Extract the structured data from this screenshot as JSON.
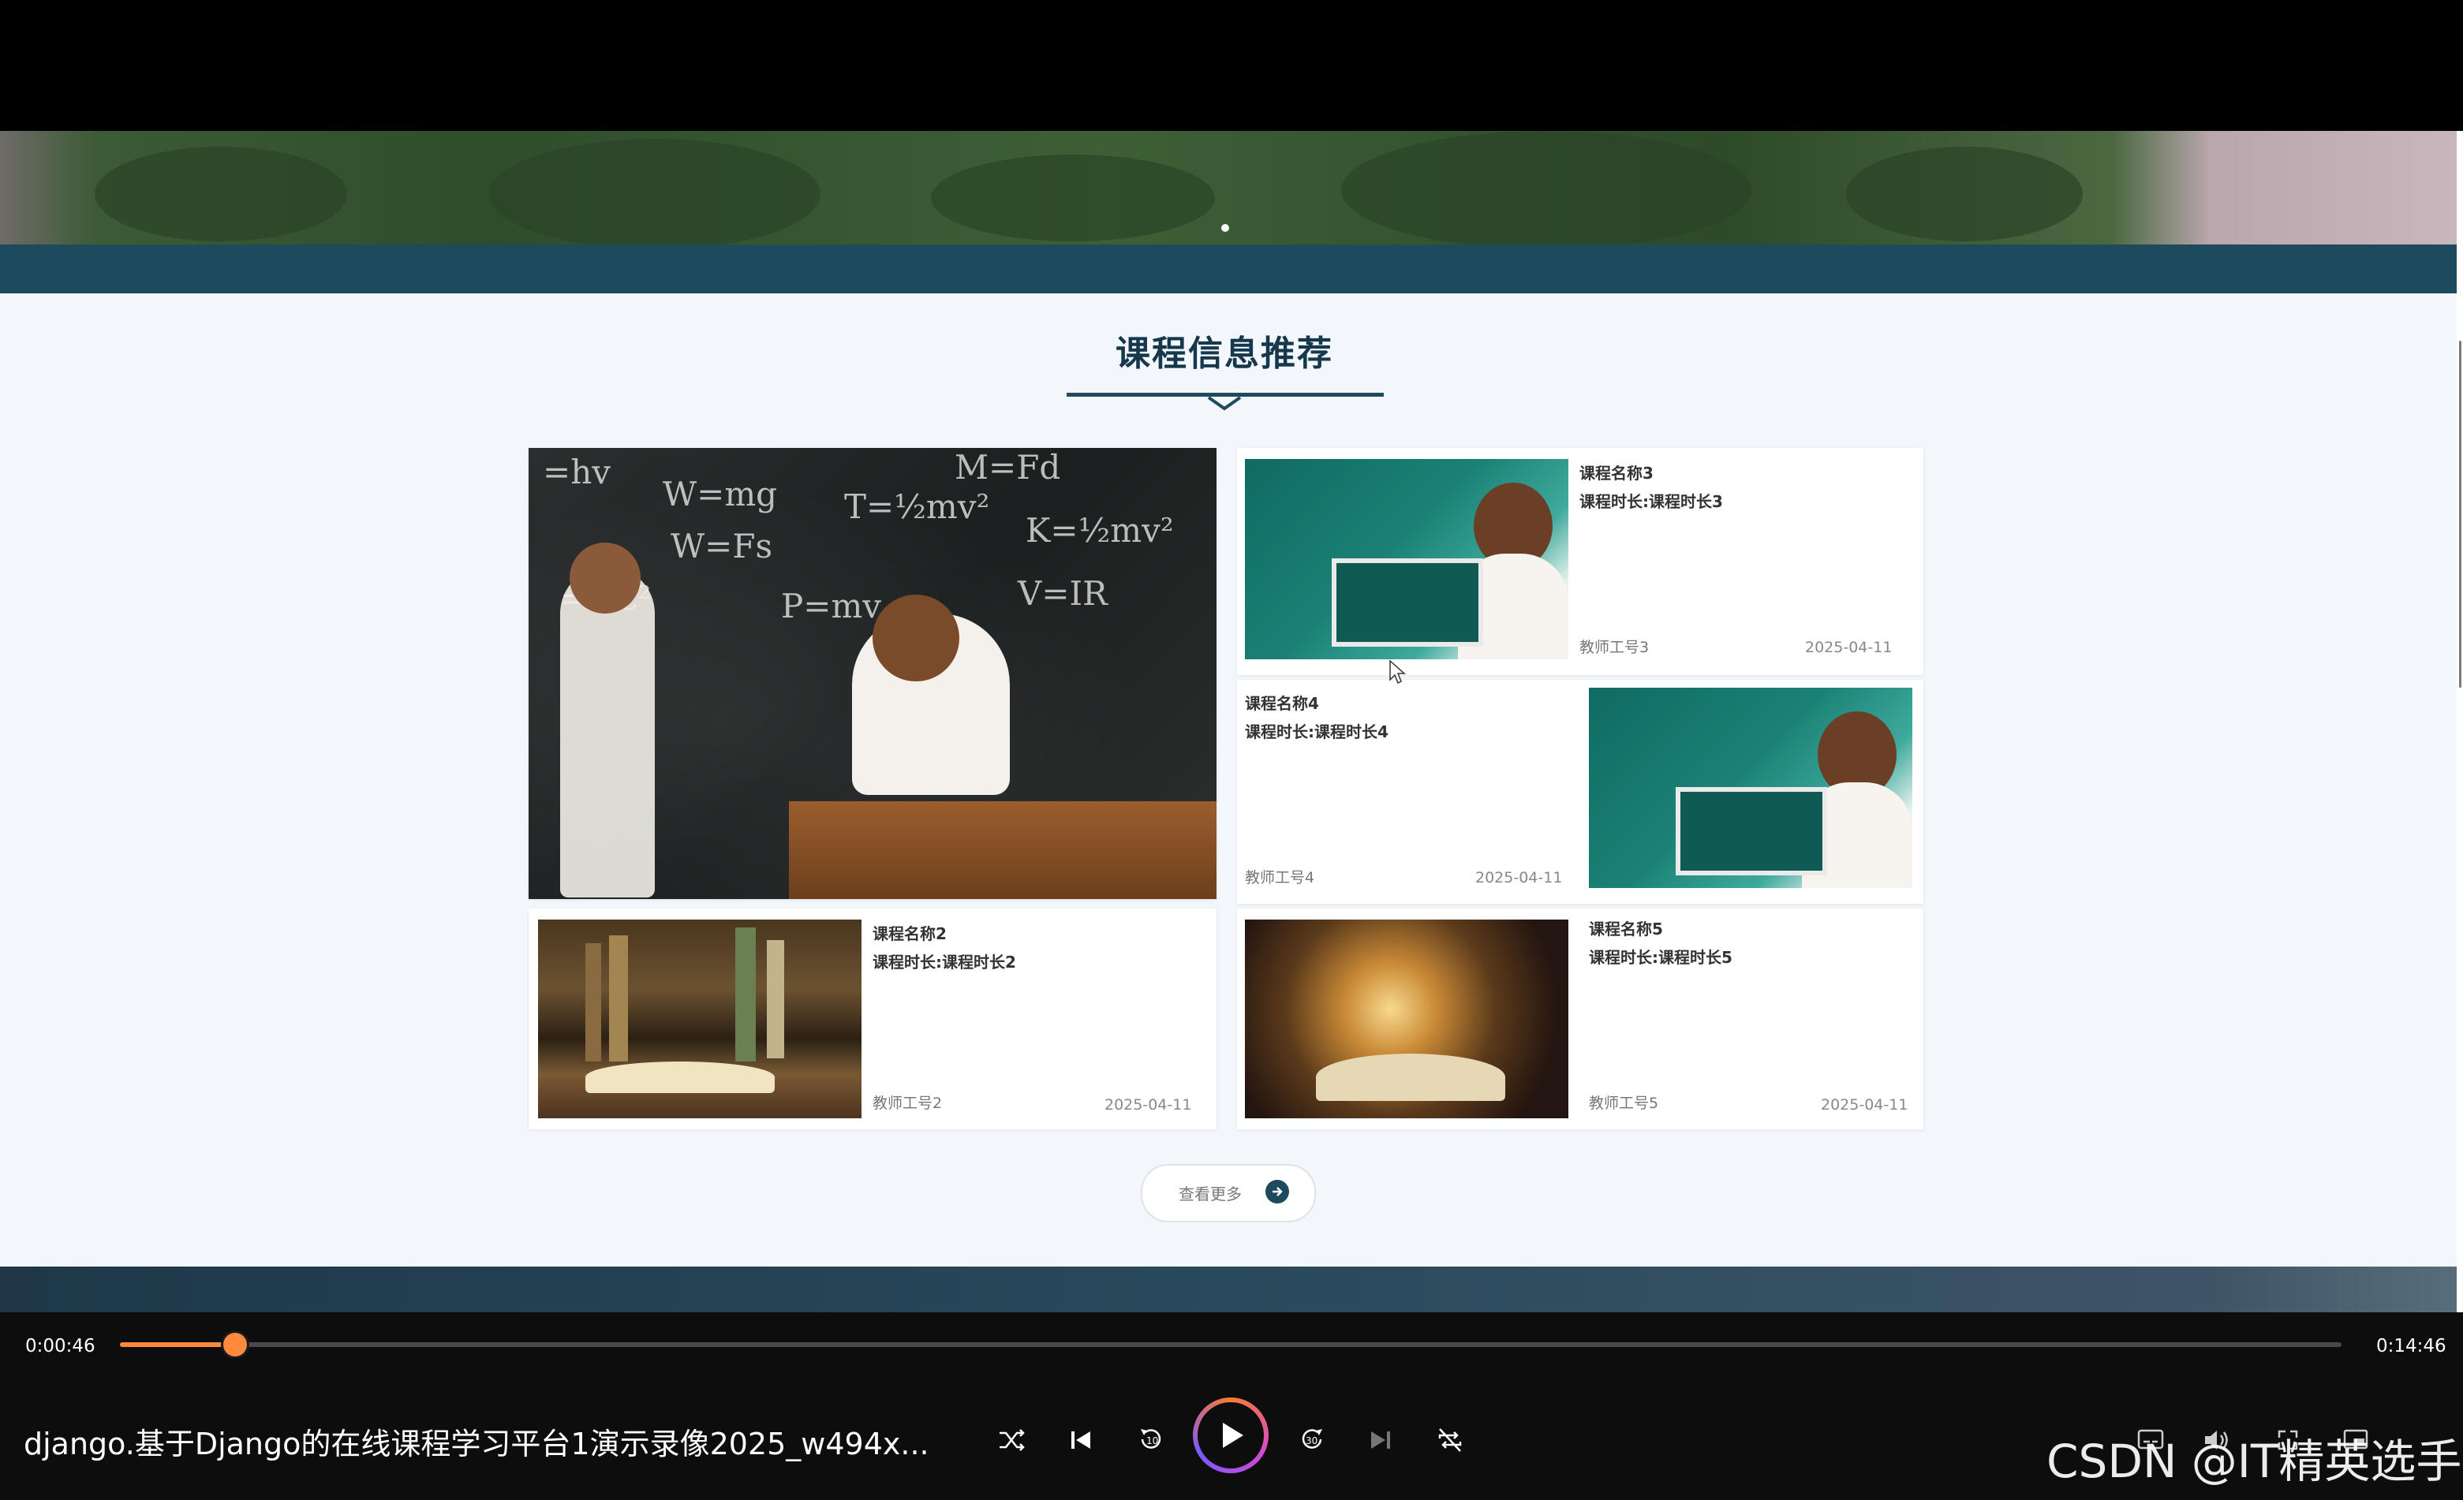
{
  "page": {
    "section_title": "课程信息推荐",
    "view_more": "查看更多"
  },
  "courses": [
    {
      "name": "",
      "duration": "",
      "teacher": "",
      "date": "",
      "image": "chalkboard-kids"
    },
    {
      "name": "课程名称2",
      "duration": "课程时长:课程时长2",
      "teacher": "教师工号2",
      "date": "2025-04-11",
      "image": "open-book-shelf"
    },
    {
      "name": "课程名称3",
      "duration": "课程时长:课程时长3",
      "teacher": "教师工号3",
      "date": "2025-04-11",
      "image": "teacher-board"
    },
    {
      "name": "课程名称4",
      "duration": "课程时长:课程时长4",
      "teacher": "教师工号4",
      "date": "2025-04-11",
      "image": "teacher-board"
    },
    {
      "name": "课程名称5",
      "duration": "课程时长:课程时长5",
      "teacher": "教师工号5",
      "date": "2025-04-11",
      "image": "glowing-book"
    }
  ],
  "player": {
    "current_time": "0:00:46",
    "total_time": "0:14:46",
    "progress_fraction": 0.052,
    "title": "django.基于Django的在线课程学习平台1演示录像2025_w494x...",
    "controls": [
      "shuffle-icon",
      "previous-icon",
      "rewind-10-icon",
      "play-icon",
      "forward-30-icon",
      "next-icon",
      "repeat-off-icon"
    ],
    "right_controls": [
      "subtitles-icon",
      "volume-icon",
      "fullscreen-icon",
      "mini-player-icon"
    ],
    "accent": "#ff8a3d"
  },
  "watermark": "CSDN @IT精英选手"
}
